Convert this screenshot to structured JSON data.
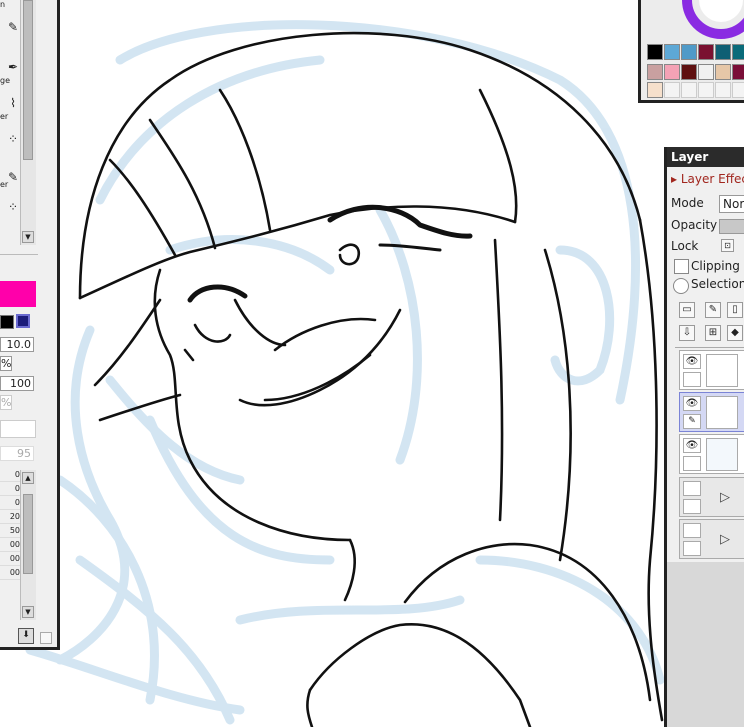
{
  "left_panel": {
    "tool_labels": [
      "n",
      "ge",
      "er",
      "er"
    ],
    "brush_size": "10.0",
    "pct_label": "%",
    "density": "100",
    "pct_label2": "%",
    "faded_value": "95",
    "size_list": [
      "0",
      "0",
      "0",
      "20",
      "50",
      "00",
      "00",
      "00"
    ],
    "colors": {
      "main": "#ff00aa",
      "fg": "#000000",
      "bg": "#1c1c7a"
    }
  },
  "palette": {
    "row1": [
      "#000000",
      "#5da8d6",
      "#4f9ac8",
      "#7a1030",
      "#0f5f74",
      "#0a6b7a"
    ],
    "row2": [
      "#c9a0a0",
      "#f4a2b5",
      "#5e1010",
      "#f1f1f1",
      "#e6c7a8",
      "#7a0e38"
    ],
    "row3": [
      "#f6e0cc"
    ]
  },
  "layer_panel": {
    "title": "Layer",
    "effect_label": "Layer Effec",
    "mode_label": "Mode",
    "mode_value": "Norm",
    "opacity_label": "Opacity",
    "lock_label": "Lock",
    "clipping_label": "Clipping G",
    "selection_label": "Selection",
    "colors": {
      "selected": "#d4d8f4",
      "effect_arrow": "#b3261e"
    }
  }
}
